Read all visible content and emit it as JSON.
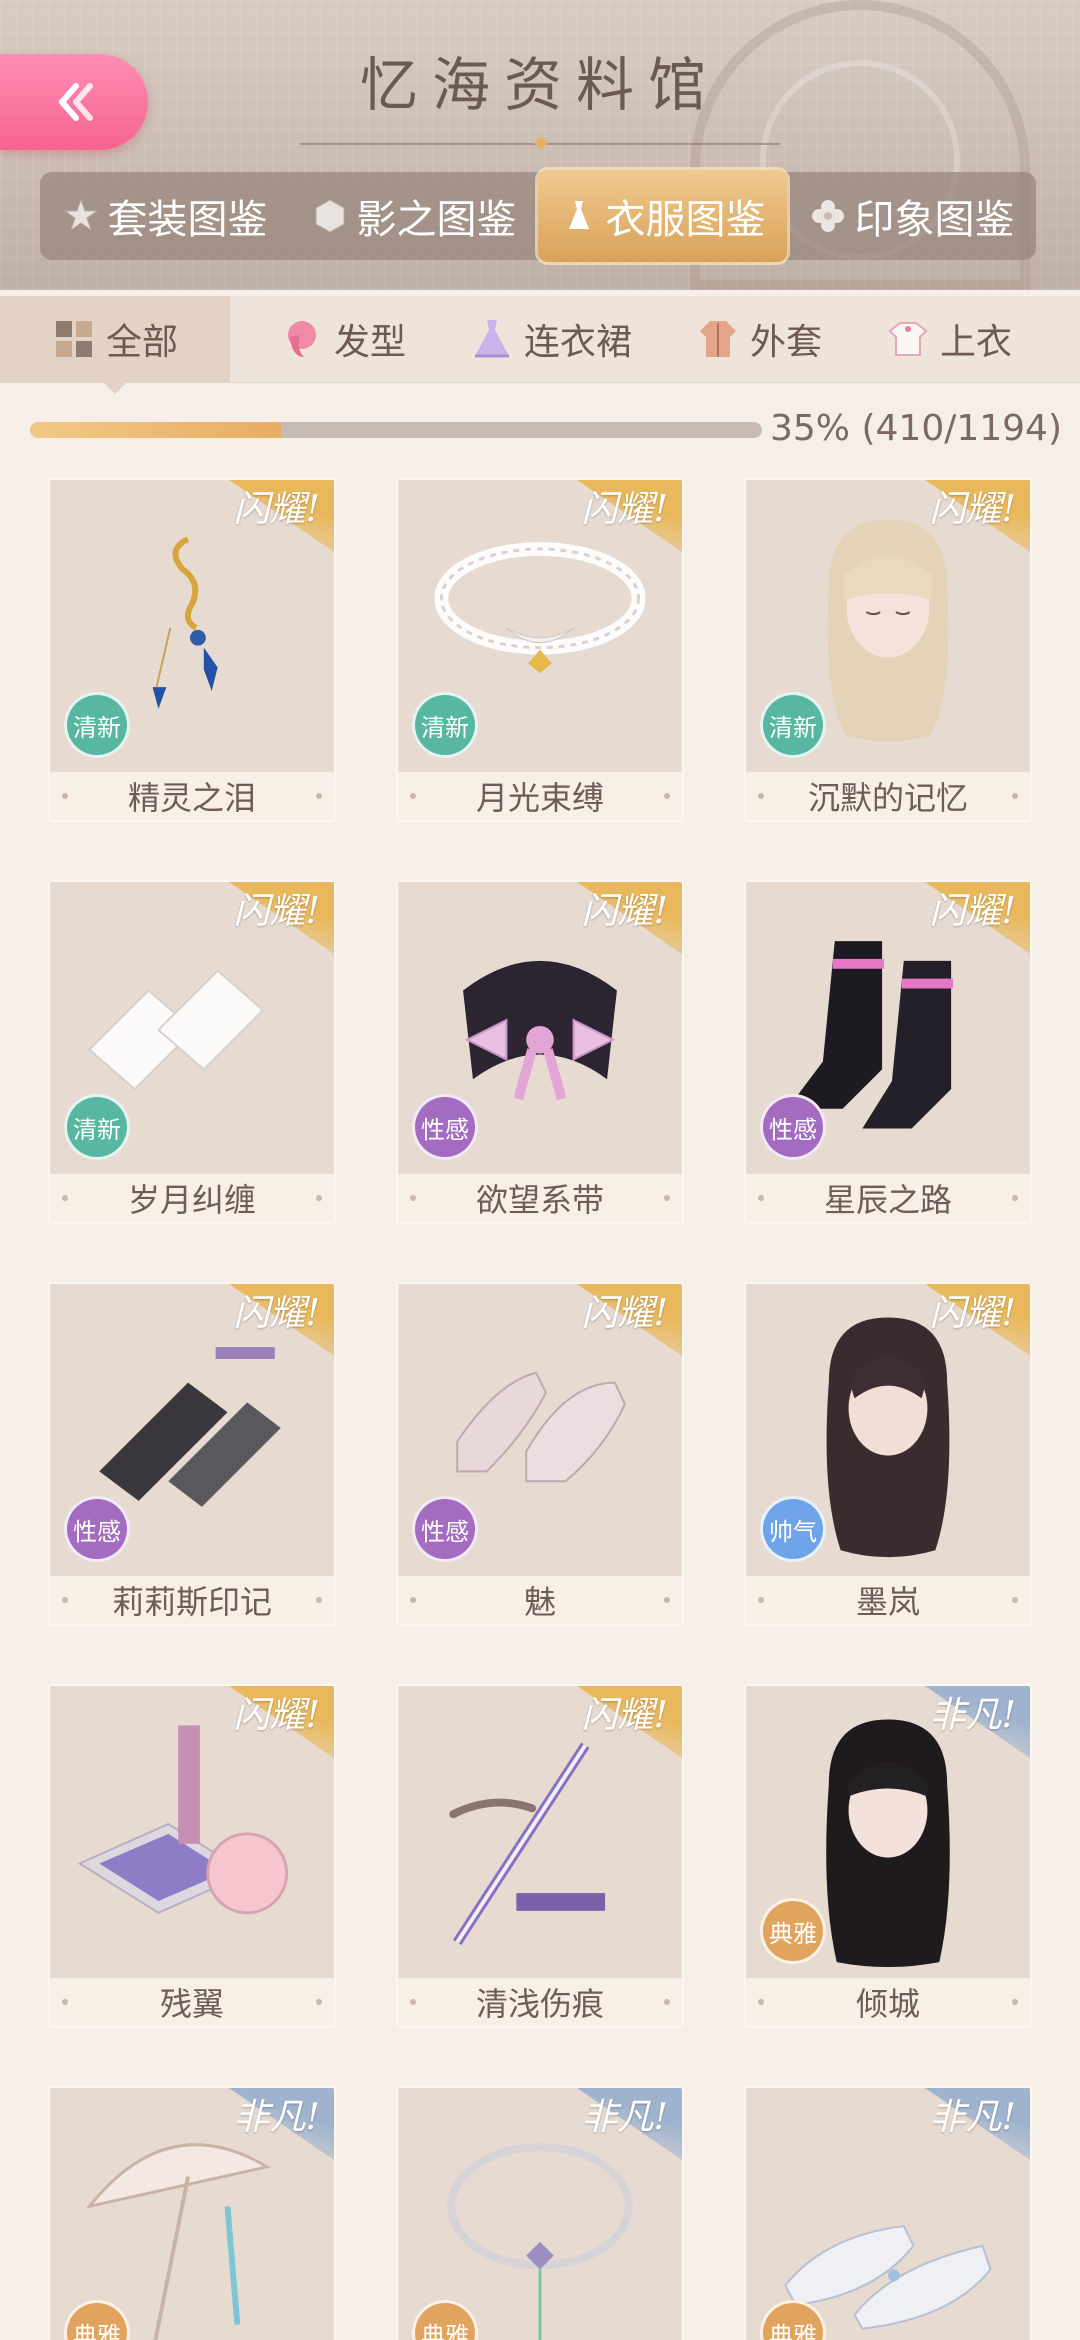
{
  "header": {
    "title": "忆海资料馆",
    "back_icon": "double-chevron-left-icon",
    "tabs": [
      {
        "label": "套装图鉴",
        "icon": "star-icon",
        "active": false
      },
      {
        "label": "影之图鉴",
        "icon": "hexagon-icon",
        "active": false
      },
      {
        "label": "衣服图鉴",
        "icon": "dress-icon",
        "active": true
      },
      {
        "label": "印象图鉴",
        "icon": "flower-icon",
        "active": false
      }
    ]
  },
  "categories": [
    {
      "label": "全部",
      "icon": "grid-icon",
      "active": true
    },
    {
      "label": "发型",
      "icon": "hair-icon",
      "active": false
    },
    {
      "label": "连衣裙",
      "icon": "dress-icon",
      "active": false
    },
    {
      "label": "外套",
      "icon": "coat-icon",
      "active": false
    },
    {
      "label": "上衣",
      "icon": "shirt-icon",
      "active": false
    }
  ],
  "progress": {
    "fraction": 0.3434,
    "text": "35% (410/1194)"
  },
  "colors": {
    "gold_ribbon": "#e9b85c",
    "blue_ribbon": "#9fb3cf",
    "qingxin": "#57b7a0",
    "xinggan": "#a36cc0",
    "shuaiqi": "#6fa4e8",
    "dianya": "#e0a45e"
  },
  "items": [
    {
      "name": "精灵之泪",
      "badge": "闪耀!",
      "rarity": "gold",
      "tag": "清新",
      "tag_color": "#57b7a0",
      "art": "earring"
    },
    {
      "name": "月光束缚",
      "badge": "闪耀!",
      "rarity": "gold",
      "tag": "清新",
      "tag_color": "#57b7a0",
      "art": "necklace"
    },
    {
      "name": "沉默的记忆",
      "badge": "闪耀!",
      "rarity": "gold",
      "tag": "清新",
      "tag_color": "#57b7a0",
      "art": "hair-blonde"
    },
    {
      "name": "岁月纠缠",
      "badge": "闪耀!",
      "rarity": "gold",
      "tag": "清新",
      "tag_color": "#57b7a0",
      "art": "lace-gloves"
    },
    {
      "name": "欲望系带",
      "badge": "闪耀!",
      "rarity": "gold",
      "tag": "性感",
      "tag_color": "#a36cc0",
      "art": "collar-bow"
    },
    {
      "name": "星辰之路",
      "badge": "闪耀!",
      "rarity": "gold",
      "tag": "性感",
      "tag_color": "#a36cc0",
      "art": "boots"
    },
    {
      "name": "莉莉斯印记",
      "badge": "闪耀!",
      "rarity": "gold",
      "tag": "性感",
      "tag_color": "#a36cc0",
      "art": "arm-sleeves"
    },
    {
      "name": "魅",
      "badge": "闪耀!",
      "rarity": "gold",
      "tag": "性感",
      "tag_color": "#a36cc0",
      "art": "heels"
    },
    {
      "name": "墨岚",
      "badge": "闪耀!",
      "rarity": "gold",
      "tag": "帅气",
      "tag_color": "#6fa4e8",
      "art": "hair-dark"
    },
    {
      "name": "残翼",
      "badge": "闪耀!",
      "rarity": "gold",
      "tag": "",
      "tag_color": "",
      "art": "makeup"
    },
    {
      "name": "清浅伤痕",
      "badge": "闪耀!",
      "rarity": "gold",
      "tag": "",
      "tag_color": "",
      "art": "brow-pencil"
    },
    {
      "name": "倾城",
      "badge": "非凡!",
      "rarity": "blue",
      "tag": "典雅",
      "tag_color": "#e0a45e",
      "art": "hair-black"
    },
    {
      "name": "",
      "badge": "非凡!",
      "rarity": "blue",
      "tag": "典雅",
      "tag_color": "#e0a45e",
      "art": "umbrella"
    },
    {
      "name": "",
      "badge": "非凡!",
      "rarity": "blue",
      "tag": "典雅",
      "tag_color": "#e0a45e",
      "art": "choker"
    },
    {
      "name": "",
      "badge": "非凡!",
      "rarity": "blue",
      "tag": "典雅",
      "tag_color": "#e0a45e",
      "art": "flats"
    }
  ]
}
